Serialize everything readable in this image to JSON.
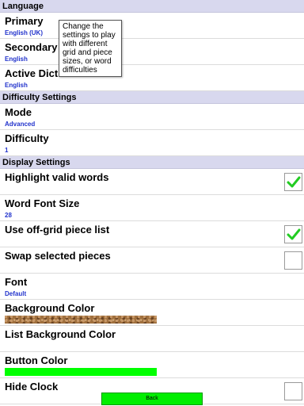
{
  "sections": {
    "language": "Language",
    "difficulty": "Difficulty Settings",
    "display": "Display Settings"
  },
  "language": {
    "primary": {
      "title": "Primary",
      "value": "English (UK)"
    },
    "secondary": {
      "title": "Secondary",
      "value": "English"
    },
    "active_dictionary": {
      "title": "Active Dicti",
      "value": "English"
    }
  },
  "tooltip": "Change the settings to play with different grid and piece sizes, or word difficulties",
  "difficulty": {
    "mode": {
      "title": "Mode",
      "value": "Advanced"
    },
    "difficulty": {
      "title": "Difficulty",
      "value": "1"
    }
  },
  "display": {
    "highlight_valid_words": {
      "title": "Highlight valid words",
      "checked": true
    },
    "word_font_size": {
      "title": "Word Font Size",
      "value": "28"
    },
    "use_offgrid_piece_list": {
      "title": "Use off-grid piece list",
      "checked": true
    },
    "swap_selected_pieces": {
      "title": "Swap selected pieces",
      "checked": false
    },
    "font": {
      "title": "Font",
      "value": "Default"
    },
    "background_color": {
      "title": "Background Color",
      "swatch": "wood-texture"
    },
    "list_background_color": {
      "title": "List Background Color"
    },
    "button_color": {
      "title": "Button Color",
      "color": "#00ff00"
    },
    "hide_clock": {
      "title": "Hide Clock",
      "checked": false
    }
  },
  "back_button": "Back",
  "colors": {
    "accent_green": "#00ee00",
    "check_green": "#22cc22",
    "value_blue": "#2233cc",
    "section_bg": "#d8d8ee"
  }
}
